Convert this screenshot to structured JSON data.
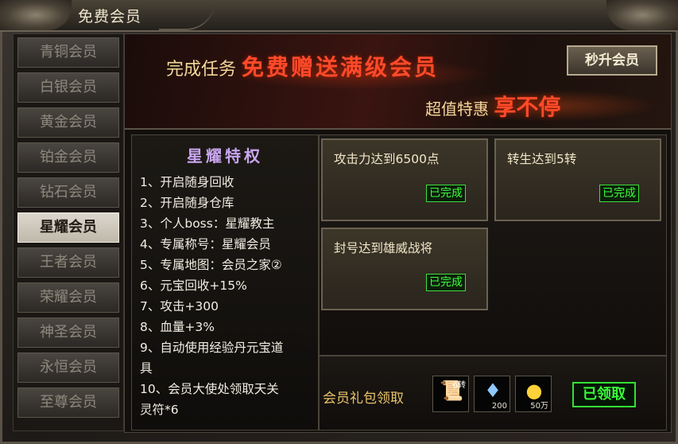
{
  "window": {
    "title": "免费会员"
  },
  "sidebar": {
    "items": [
      {
        "label": "青铜会员",
        "active": false
      },
      {
        "label": "白银会员",
        "active": false
      },
      {
        "label": "黄金会员",
        "active": false
      },
      {
        "label": "铂金会员",
        "active": false
      },
      {
        "label": "钻石会员",
        "active": false
      },
      {
        "label": "星耀会员",
        "active": true
      },
      {
        "label": "王者会员",
        "active": false
      },
      {
        "label": "荣耀会员",
        "active": false
      },
      {
        "label": "神圣会员",
        "active": false
      },
      {
        "label": "永恒会员",
        "active": false
      },
      {
        "label": "至尊会员",
        "active": false
      }
    ]
  },
  "banner": {
    "line1_prefix": "完成任务",
    "line1_highlight": "免费赠送满级会员",
    "line2_prefix": "超值特惠",
    "line2_highlight": "享不停",
    "upgrade_button": "秒升会员"
  },
  "privileges": {
    "title": "星耀特权",
    "items": [
      "1、开启随身回收",
      "2、开启随身仓库",
      "3、个人boss：星耀教主",
      "4、专属称号：星耀会员",
      "5、专属地图：会员之家②",
      "6、元宝回收+15%",
      "7、攻击+300",
      "8、血量+3%",
      "9、自动使用经验丹元宝道\n具",
      "10、会员大使处领取天关\n灵符*6"
    ]
  },
  "tasks": [
    {
      "title": "攻击力达到6500点",
      "status": "已完成"
    },
    {
      "title": "转生达到5转",
      "status": "已完成"
    },
    {
      "title": "封号达到雄威战将",
      "status": "已完成"
    }
  ],
  "gift": {
    "label": "会员礼包领取",
    "items": [
      {
        "icon": "talisman-icon",
        "qty": "6转"
      },
      {
        "icon": "crystal-icon",
        "qty": "200"
      },
      {
        "icon": "gold-ingot-icon",
        "qty": "50万"
      }
    ],
    "claim_button": "已领取"
  },
  "colors": {
    "accent_red": "#ff4a2a",
    "gold_text": "#f4d79a",
    "privilege_title": "#c8a6f0",
    "done_green": "#3dff3d"
  }
}
